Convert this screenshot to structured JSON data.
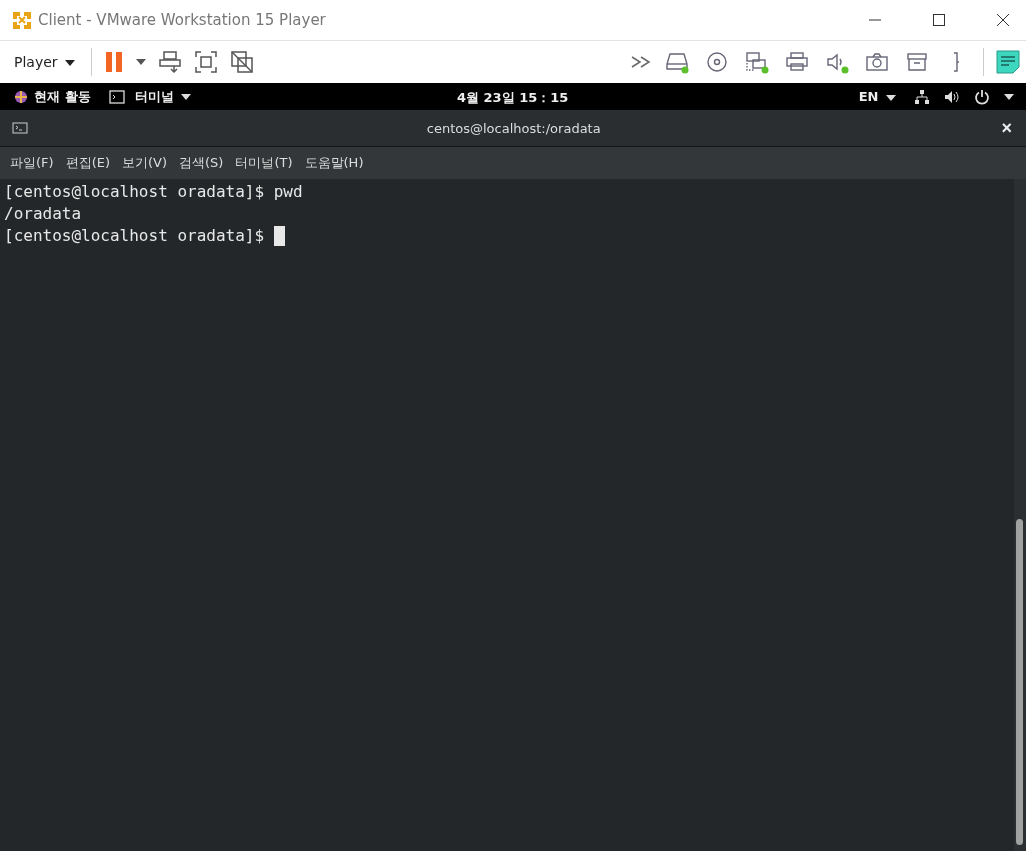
{
  "window": {
    "title": "Client - VMware Workstation 15 Player"
  },
  "toolbar": {
    "player_menu": "Player"
  },
  "devices": [
    {
      "kind": "hdd",
      "connected": true
    },
    {
      "kind": "cd",
      "connected": false
    },
    {
      "kind": "network",
      "connected": true
    },
    {
      "kind": "printer",
      "connected": false
    },
    {
      "kind": "sound",
      "connected": true
    },
    {
      "kind": "camera",
      "connected": false
    },
    {
      "kind": "archive",
      "connected": false
    },
    {
      "kind": "bracket",
      "connected": false
    }
  ],
  "topbar": {
    "activities": "현재 활동",
    "app_menu": "터미널",
    "clock": "4월 23일  15：15",
    "language": "EN"
  },
  "terminal": {
    "title": "centos@localhost:/oradata",
    "close": "×",
    "menu": [
      "파일(F)",
      "편집(E)",
      "보기(V)",
      "검색(S)",
      "터미널(T)",
      "도움말(H)"
    ],
    "lines": [
      "[centos@localhost oradata]$ pwd",
      "/oradata",
      "[centos@localhost oradata]$ "
    ]
  }
}
